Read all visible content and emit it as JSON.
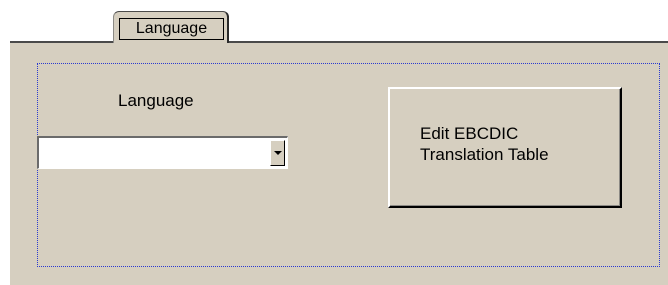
{
  "tab": {
    "label": "Language"
  },
  "language": {
    "label": "Language",
    "selected_value": ""
  },
  "edit_button": {
    "label": "Edit EBCDIC\nTranslation Table"
  }
}
